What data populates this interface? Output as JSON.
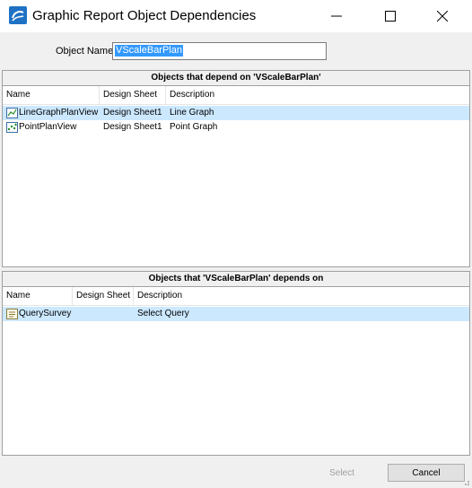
{
  "window": {
    "title": "Graphic Report Object Dependencies"
  },
  "object_name": {
    "label": "Object Name",
    "value": "VScaleBarPlan"
  },
  "dependents_panel": {
    "header": "Objects that depend on 'VScaleBarPlan'",
    "columns": [
      "Name",
      "Design Sheet",
      "Description"
    ],
    "rows": [
      {
        "name": "LineGraphPlanView",
        "design_sheet": "Design Sheet1",
        "description": "Line Graph",
        "icon": "line-graph-icon",
        "selected": true
      },
      {
        "name": "PointPlanView",
        "design_sheet": "Design Sheet1",
        "description": "Point Graph",
        "icon": "point-graph-icon",
        "selected": false
      }
    ]
  },
  "dependencies_panel": {
    "header": "Objects that 'VScaleBarPlan' depends on",
    "columns": [
      "Name",
      "Design Sheet",
      "Description"
    ],
    "rows": [
      {
        "name": "QuerySurvey",
        "design_sheet": "",
        "description": "Select Query",
        "icon": "query-icon",
        "selected": true
      }
    ]
  },
  "buttons": {
    "select": "Select",
    "cancel": "Cancel"
  },
  "colors": {
    "selection": "#cce8ff",
    "accent": "#1f72c4",
    "text_highlight": "#3399ff"
  }
}
